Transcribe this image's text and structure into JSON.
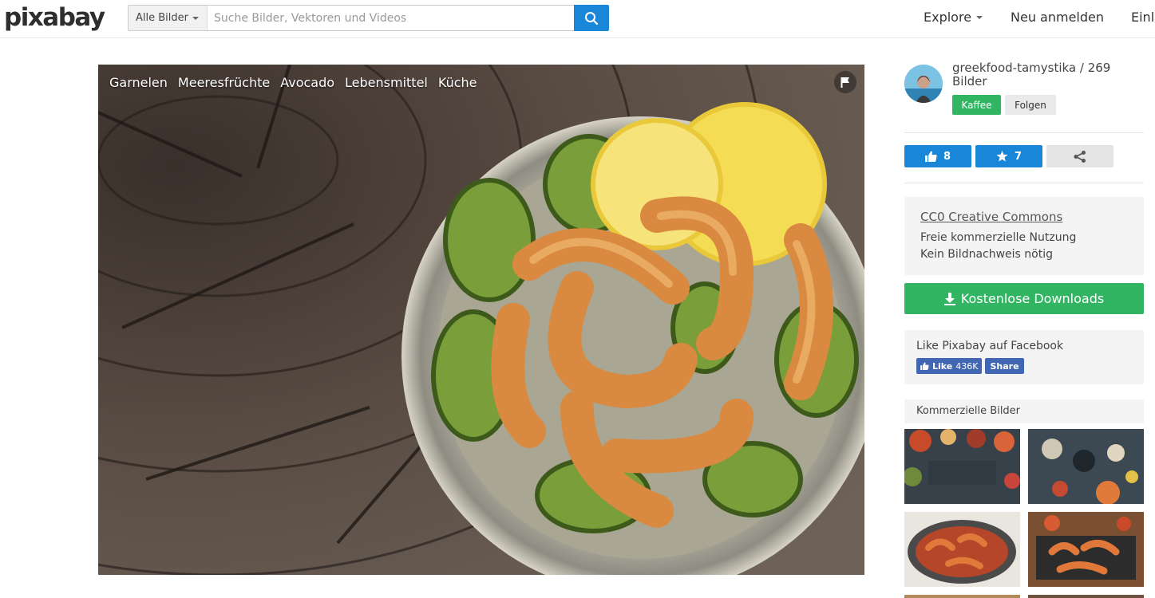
{
  "header": {
    "logo": "pixabay",
    "search": {
      "category": "Alle Bilder",
      "placeholder": "Suche Bilder, Vektoren und Videos",
      "value": ""
    },
    "nav": {
      "explore": "Explore",
      "signup": "Neu anmelden",
      "login": "Einlo"
    }
  },
  "photo": {
    "tags": [
      "Garnelen",
      "Meeresfrüchte",
      "Avocado",
      "Lebensmittel",
      "Küche"
    ]
  },
  "author": {
    "name": "greekfood-tamystika / 269 Bilder",
    "coffee_label": "Kaffee",
    "follow_label": "Folgen"
  },
  "stats": {
    "likes": "8",
    "favorites": "7"
  },
  "license": {
    "title": "CC0 Creative Commons",
    "line1": "Freie kommerzielle Nutzung",
    "line2": "Kein Bildnachweis nötig"
  },
  "download": {
    "label": "Kostenlose Downloads"
  },
  "facebook": {
    "title": "Like Pixabay auf Facebook",
    "like_label": "Like",
    "like_count": "436K",
    "share_label": "Share"
  },
  "commercial": {
    "title": "Kommerzielle Bilder"
  },
  "colors": {
    "accent_blue": "#1a86d8",
    "accent_green": "#32b562",
    "facebook_blue": "#4267b2"
  }
}
